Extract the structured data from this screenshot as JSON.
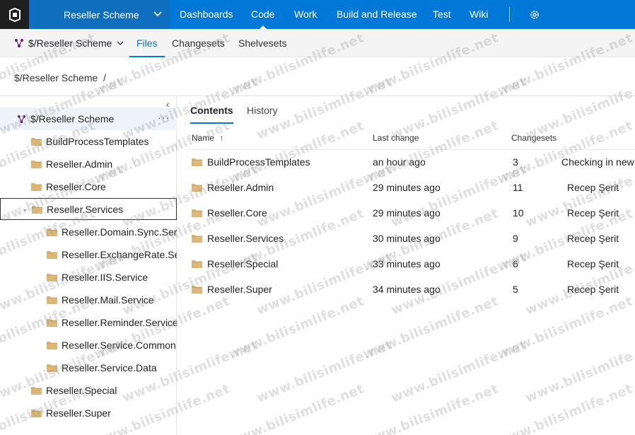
{
  "topnav": {
    "project": "Reseller Scheme",
    "items": [
      "Dashboards",
      "Code",
      "Work",
      "Build and Release",
      "Test",
      "Wiki"
    ],
    "active": "Code"
  },
  "subnav": {
    "repo": "$/Reseller Scheme",
    "tabs": [
      "Files",
      "Changesets",
      "Shelvesets"
    ],
    "active": "Files"
  },
  "breadcrumb": "$/Reseller Scheme  /",
  "tree": {
    "root": "$/Reseller Scheme",
    "more": "···",
    "items": [
      {
        "label": "BuildProcessTemplates",
        "level": 1
      },
      {
        "label": "Reseller.Admin",
        "level": 1
      },
      {
        "label": "Reseller.Core",
        "level": 1
      },
      {
        "label": "Reseller.Services",
        "level": 1,
        "expanded": true,
        "selected": true
      },
      {
        "label": "Reseller.Domain.Sync.Ser...",
        "level": 2
      },
      {
        "label": "Reseller.ExchangeRate.Se...",
        "level": 2
      },
      {
        "label": "Reseller.IIS.Service",
        "level": 2
      },
      {
        "label": "Reseller.Mail.Service",
        "level": 2
      },
      {
        "label": "Reseller.Reminder.Service",
        "level": 2
      },
      {
        "label": "Reseller.Service.Common",
        "level": 2
      },
      {
        "label": "Reseller.Service.Data",
        "level": 2
      },
      {
        "label": "Reseller.Special",
        "level": 1
      },
      {
        "label": "Reseller.Super",
        "level": 1
      }
    ]
  },
  "content": {
    "tabs": [
      "Contents",
      "History"
    ],
    "active": "Contents",
    "columns": [
      "Name",
      "Last change",
      "Changesets"
    ],
    "sort_icon": "↑",
    "rows": [
      {
        "name": "BuildProcessTemplates",
        "last_change": "an hour ago",
        "changesets": "3",
        "comment": "Checking in new"
      },
      {
        "name": "Reseller.Admin",
        "last_change": "29 minutes ago",
        "changesets": "11",
        "comment": "Recep Şerit"
      },
      {
        "name": "Reseller.Core",
        "last_change": "29 minutes ago",
        "changesets": "10",
        "comment": "Recep Şerit"
      },
      {
        "name": "Reseller.Services",
        "last_change": "30 minutes ago",
        "changesets": "9",
        "comment": "Recep Şerit"
      },
      {
        "name": "Reseller.Special",
        "last_change": "33 minutes ago",
        "changesets": "6",
        "comment": "Recep Şerit"
      },
      {
        "name": "Reseller.Super",
        "last_change": "34 minutes ago",
        "changesets": "5",
        "comment": "Recep Şerit"
      }
    ]
  },
  "watermark": "www.bilisimlife.net",
  "colors": {
    "accent": "#0078d7",
    "folder": "#dcb67a"
  }
}
